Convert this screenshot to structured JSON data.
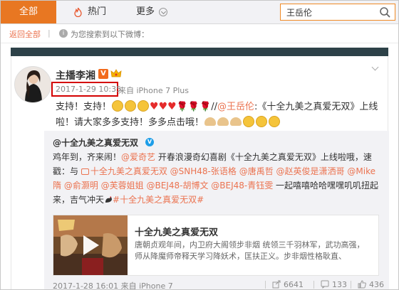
{
  "tabs": {
    "all": "全部",
    "hot": "热门",
    "more": "更多"
  },
  "search": {
    "value": "王岳伦",
    "placeholder": ""
  },
  "hint": {
    "back": "返回全部",
    "separator": "|",
    "info_symbol": "i",
    "text": "为您搜索到以下微博："
  },
  "post": {
    "author": "主播李湘",
    "vip": "V",
    "time": "2017-1-29 10:35",
    "source": "来自 iPhone 7 Plus",
    "line1_a": "支持！支持！",
    "line1_b": "//",
    "mention": "@王岳伦",
    "line1_c": ":《十全九美之真爱无双》上线",
    "line2": "啦！请大家多多支持！多多点击哦！",
    "heart": "♥",
    "rose": "🌹"
  },
  "repost": {
    "author": "@十全九美之真爱无双",
    "verified": "V",
    "t1": "鸡年到，齐来闹！",
    "m_iqiyi": "@爱奇艺",
    "t2": " 开春浪漫奇幻喜剧《十全九美之真爱无双》上线啦哦，速戳：",
    "t3": "与 ",
    "l_link": "十全九美之真爱无双",
    "m1": " @SNH48-张语格",
    "m2": " @唐禹哲",
    "m3": " @赵英俊是潇洒哥",
    "m4": " @Mike隋",
    "m5": " @俞灏明",
    "m6": " @芙蓉姐姐",
    "m7": " @BEJ48-胡博文",
    "m8": " @BEJ48-青钰雯",
    "t4": " 一起嘻嘻哈哈嘿嘿叽叽扭起来，吉气冲天",
    "tag": "#十全九美之真爱无双#",
    "time": "2017-1-28 16:01 来自 iPhone 7",
    "shares": "6641",
    "comments": "133",
    "likes": "436"
  },
  "video": {
    "title": "十全九美之真爱无双",
    "desc": "唐朝贞观年间，内卫府大阁领步非烟 统领三千羽林军，武功高强，师从降魔师帝释天学习降妖术，匡扶正义。步非烟性格耿直、"
  },
  "colors": {
    "accent": "#e87722",
    "link": "#eb7350",
    "highlight_box": "#d40000",
    "verified_blue": "#1e9ee8"
  }
}
